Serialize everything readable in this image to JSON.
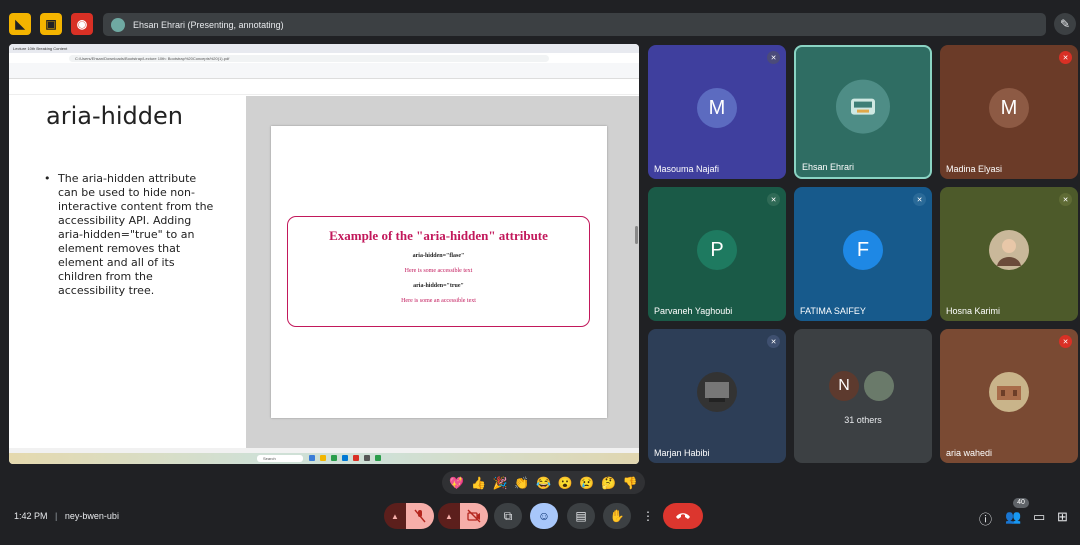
{
  "top_bar": {
    "presenter_label": "Ehsan Ehrari (Presenting, annotating)"
  },
  "shared_screen": {
    "browser_tab": "Lecture 10th Breaking Content",
    "url": "C:/Users/Ehsan/Downloads/Bootstrap/Lecture 10th: Bootstrap%20Concepts%20(1).pdf",
    "slide": {
      "title": "aria-hidden",
      "bullet": "The aria-hidden attribute can be used to hide non-interactive content from the accessibility API. Adding aria-hidden=\"true\" to an element removes that element and all of its children from the accessibility tree."
    },
    "example": {
      "title": "Example of the \"aria-hidden\" attribute",
      "line1": "aria-hidden=\"flase\"",
      "line2": "Here is some accessible text",
      "line3": "aria-hidden=\"true\"",
      "line4": "Here is some an accessible text"
    },
    "taskbar_search": "Search"
  },
  "participants": [
    {
      "name": "Masouma Najafi",
      "initial": "M",
      "color": "#5c6bc0",
      "bg": "#3f3f9e"
    },
    {
      "name": "Ehsan Ehrari",
      "initial": "",
      "color": "#4e8d86",
      "bg": "#2f6d63"
    },
    {
      "name": "Madina Elyasi",
      "initial": "M",
      "color": "#8d5a44",
      "bg": "#6b3b28"
    },
    {
      "name": "Parvaneh Yaghoubi",
      "initial": "P",
      "color": "#1e7a60",
      "bg": "#1a5a47"
    },
    {
      "name": "FATIMA SAIFEY",
      "initial": "F",
      "color": "#1e88e5",
      "bg": "#175a8c"
    },
    {
      "name": "Hosna Karimi",
      "initial": "",
      "color": "#7a8a4a",
      "bg": "#4d5a2a"
    },
    {
      "name": "Marjan Habibi",
      "initial": "",
      "color": "#333",
      "bg": "#2d3e57"
    },
    {
      "name": "",
      "initial": "N",
      "color": "#5d3a2e",
      "bg": "#3c4043"
    },
    {
      "name": "aria wahedi",
      "initial": "",
      "color": "#a0785a",
      "bg": "#7a4a33"
    }
  ],
  "others": {
    "count_label": "31 others"
  },
  "reactions": [
    "💖",
    "👍",
    "🎉",
    "👏",
    "😂",
    "😮",
    "😢",
    "🤔",
    "👎"
  ],
  "bottom": {
    "time": "1:42 PM",
    "separator": "|",
    "meeting_code": "ney-bwen-ubi",
    "people_count": "40"
  },
  "icons": {
    "mute": "mic-off-icon",
    "camera": "camera-off-icon",
    "present": "present-icon",
    "emoji": "emoji-icon",
    "captions": "captions-icon",
    "hand": "raise-hand-icon",
    "more": "more-icon",
    "end": "end-call-icon"
  }
}
